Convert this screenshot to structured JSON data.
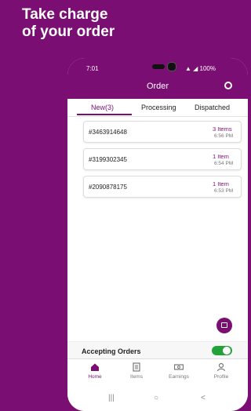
{
  "promo": {
    "headline_line1": "Take charge",
    "headline_line2": "of your order"
  },
  "status_bar": {
    "time": "7:01",
    "system_icons": "▲ ◢ 100%"
  },
  "app_bar": {
    "title": "Order"
  },
  "tabs": [
    {
      "label": "New(3)",
      "active": true
    },
    {
      "label": "Processing",
      "active": false
    },
    {
      "label": "Dispatched",
      "active": false
    }
  ],
  "orders": [
    {
      "id": "#3463914648",
      "items": "3 Items",
      "time": "6:56 PM"
    },
    {
      "id": "#3199302345",
      "items": "1 Item",
      "time": "6:54 PM"
    },
    {
      "id": "#2090878175",
      "items": "1 Item",
      "time": "6:53 PM"
    }
  ],
  "accepting_orders": {
    "label": "Accepting Orders",
    "enabled": true
  },
  "bottom_nav": [
    {
      "label": "Home",
      "icon": "home-icon",
      "active": true
    },
    {
      "label": "Items",
      "icon": "items-icon",
      "active": false
    },
    {
      "label": "Earnings",
      "icon": "earnings-icon",
      "active": false
    },
    {
      "label": "Profile",
      "icon": "profile-icon",
      "active": false
    }
  ],
  "system_nav": {
    "recents": "|||",
    "home": "○",
    "back": "<"
  },
  "colors": {
    "brand": "#7b0e73",
    "toggle_on": "#22a33a"
  }
}
